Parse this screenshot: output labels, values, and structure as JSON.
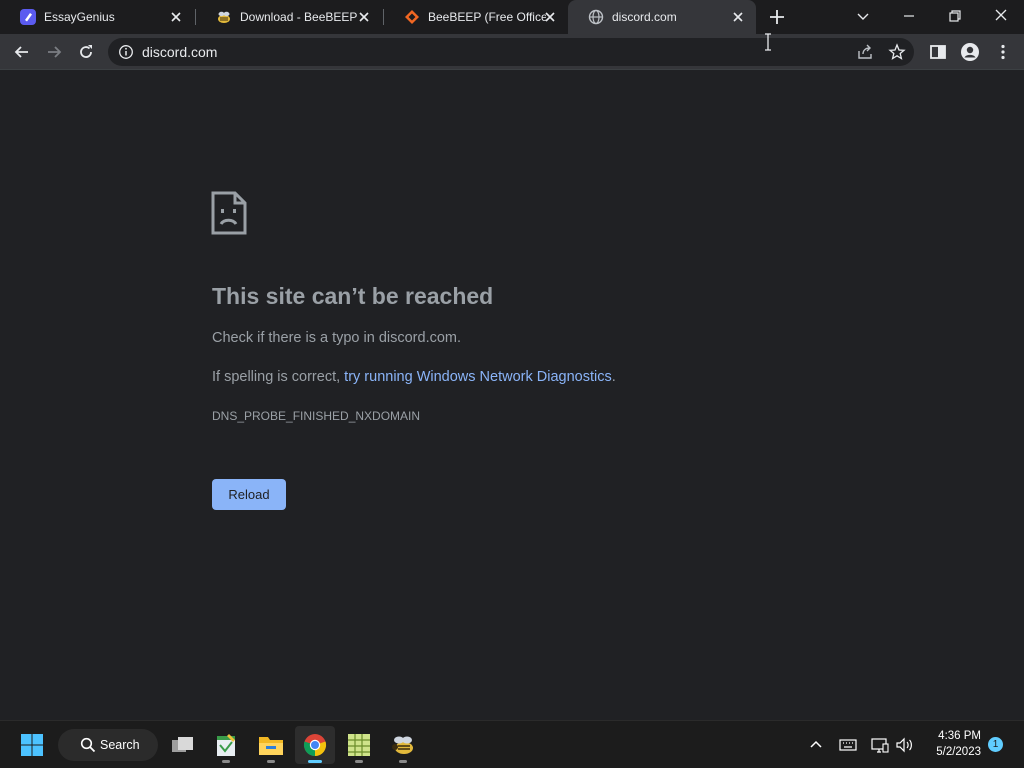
{
  "tabs": [
    {
      "title": "EssayGenius",
      "favicon": "essaygenius-icon",
      "active": false
    },
    {
      "title": "Download - BeeBEEP - ",
      "favicon": "beebeep-icon",
      "active": false
    },
    {
      "title": "BeeBEEP (Free Office M",
      "favicon": "sourceforge-icon",
      "active": false
    },
    {
      "title": "discord.com",
      "favicon": "globe-icon",
      "active": true
    }
  ],
  "address_bar": {
    "url": "discord.com"
  },
  "error_page": {
    "title": "This site can’t be reached",
    "line1": "Check if there is a typo in discord.com.",
    "line2_prefix": "If spelling is correct, ",
    "line2_link": "try running Windows Network Diagnostics",
    "line2_suffix": ".",
    "error_code": "DNS_PROBE_FINISHED_NXDOMAIN",
    "reload_label": "Reload"
  },
  "taskbar": {
    "search_label": "Search",
    "time": "4:36 PM",
    "date": "5/2/2023",
    "notification_count": "1"
  },
  "colors": {
    "page_bg": "#202124",
    "link": "#8ab4f8",
    "text": "#9aa0a6",
    "accent": "#60cdff"
  }
}
